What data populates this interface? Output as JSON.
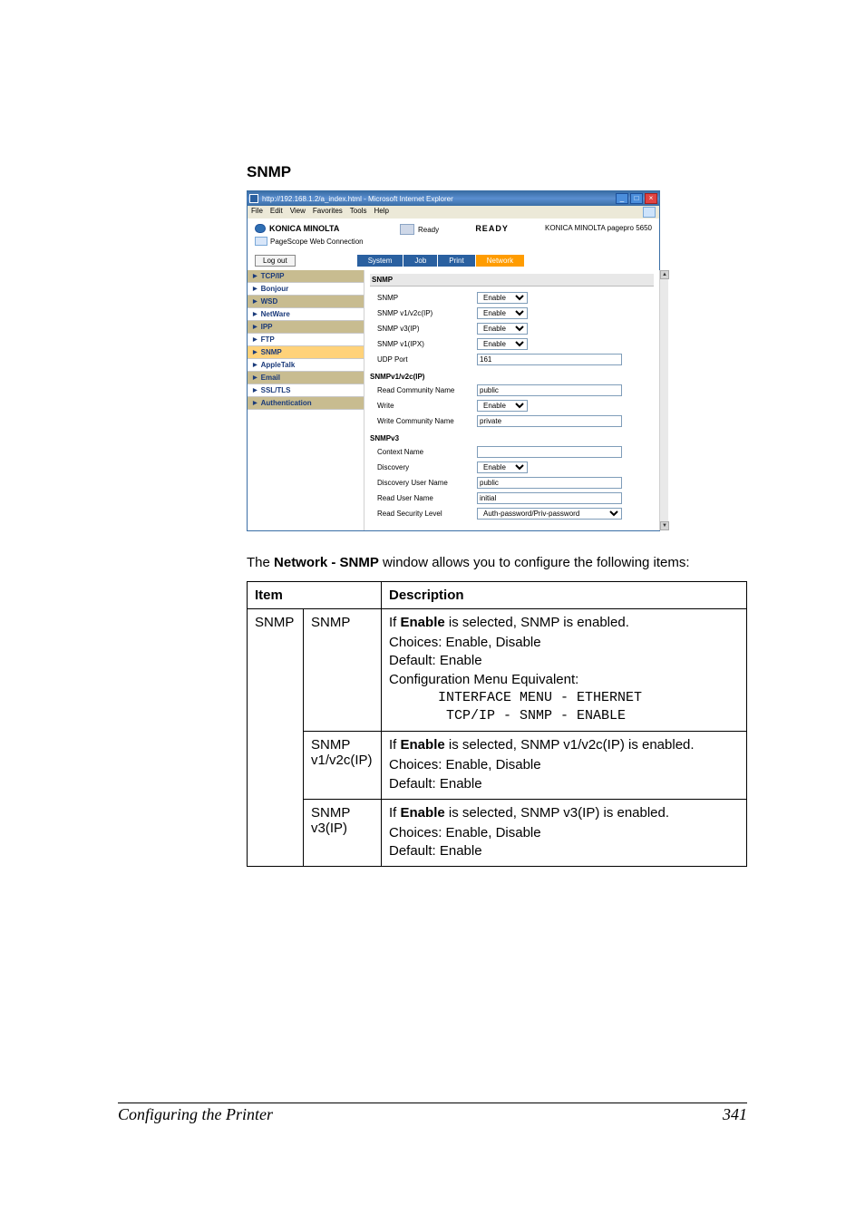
{
  "heading": "SNMP",
  "ie": {
    "title": "http://192.168.1.2/a_index.html - Microsoft Internet Explorer",
    "menus": [
      "File",
      "Edit",
      "View",
      "Favorites",
      "Tools",
      "Help"
    ],
    "min": "_",
    "max": "□",
    "close": "×"
  },
  "app": {
    "brand": "KONICA MINOLTA",
    "pagescope": "PageScope Web Connection",
    "statusLabel": "Ready",
    "readyBig": "READY",
    "model": "KONICA MINOLTA pagepro 5650",
    "logout": "Log out",
    "tabs": {
      "system": "System",
      "job": "Job",
      "print": "Print",
      "network": "Network"
    }
  },
  "sidebar": [
    {
      "label": "TCP/IP",
      "odd": true
    },
    {
      "label": "Bonjour",
      "odd": false
    },
    {
      "label": "WSD",
      "odd": true
    },
    {
      "label": "NetWare",
      "odd": false
    },
    {
      "label": "IPP",
      "odd": true
    },
    {
      "label": "FTP",
      "odd": false
    },
    {
      "label": "SNMP",
      "odd": true,
      "active": true
    },
    {
      "label": "AppleTalk",
      "odd": false
    },
    {
      "label": "Email",
      "odd": true
    },
    {
      "label": "SSL/TLS",
      "odd": false
    },
    {
      "label": "Authentication",
      "odd": true
    }
  ],
  "form": {
    "sectionMain": "SNMP",
    "rows1": [
      {
        "label": "SNMP",
        "type": "select",
        "value": "Enable"
      },
      {
        "label": "SNMP v1/v2c(IP)",
        "type": "select",
        "value": "Enable"
      },
      {
        "label": "SNMP v3(IP)",
        "type": "select",
        "value": "Enable"
      },
      {
        "label": "SNMP v1(IPX)",
        "type": "select",
        "value": "Enable"
      },
      {
        "label": "UDP Port",
        "type": "text",
        "value": "161"
      }
    ],
    "section2": "SNMPv1/v2c(IP)",
    "rows2": [
      {
        "label": "Read Community Name",
        "type": "text",
        "value": "public"
      },
      {
        "label": "Write",
        "type": "select",
        "value": "Enable"
      },
      {
        "label": "Write Community Name",
        "type": "text",
        "value": "private"
      }
    ],
    "section3": "SNMPv3",
    "rows3": [
      {
        "label": "Context Name",
        "type": "text",
        "value": ""
      },
      {
        "label": "Discovery",
        "type": "select",
        "value": "Enable"
      },
      {
        "label": "Discovery User Name",
        "type": "text",
        "value": "public"
      },
      {
        "label": "Read User Name",
        "type": "text",
        "value": "initial"
      },
      {
        "label": "Read Security Level",
        "type": "select-wide",
        "value": "Auth-password/Priv-password"
      }
    ]
  },
  "caption": {
    "pre": "The ",
    "bold": "Network - SNMP",
    "post": " window allows you to configure the following items:"
  },
  "table": {
    "headItem": "Item",
    "headDesc": "Description",
    "groupLabel": "SNMP",
    "r1sub": "SNMP",
    "r1line1a": "If ",
    "r1line1b": "Enable",
    "r1line1c": " is selected, SNMP is enabled.",
    "r1block": {
      "l1": "Choices: Enable, Disable",
      "l2": "Default:  Enable",
      "l3": "Configuration Menu Equivalent:",
      "m1": "      INTERFACE MENU - ETHERNET",
      "m2": "       TCP/IP - SNMP - ENABLE"
    },
    "r2sub": "SNMP v1/v2c(IP)",
    "r2line1a": "If ",
    "r2line1b": "Enable",
    "r2line1c": " is selected, SNMP v1/v2c(IP) is enabled.",
    "r2block": {
      "l1": "Choices: Enable, Disable",
      "l2": "Default:  Enable"
    },
    "r3sub": "SNMP v3(IP)",
    "r3line1a": "If ",
    "r3line1b": "Enable",
    "r3line1c": " is selected, SNMP v3(IP) is enabled.",
    "r3block": {
      "l1": "Choices: Enable, Disable",
      "l2": "Default:  Enable"
    }
  },
  "footer": {
    "left": "Configuring the Printer",
    "right": "341"
  }
}
